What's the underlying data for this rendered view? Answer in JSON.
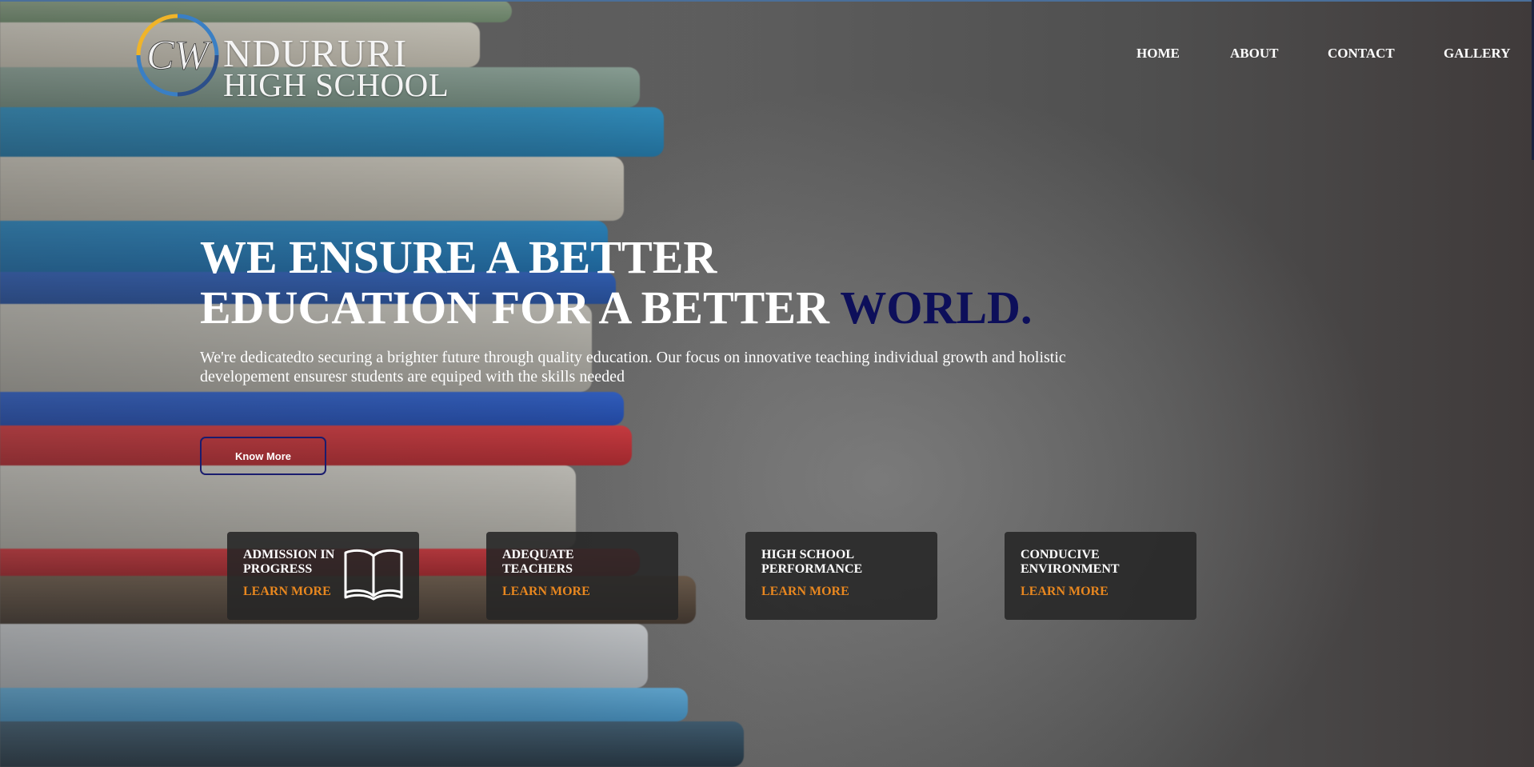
{
  "logo": {
    "monogram": "CW",
    "line1": "NDURURI",
    "line2": "HIGH SCHOOL"
  },
  "nav": {
    "items": [
      {
        "label": "HOME"
      },
      {
        "label": "ABOUT"
      },
      {
        "label": "CONTACT"
      },
      {
        "label": "GALLERY"
      }
    ]
  },
  "hero": {
    "title_line1": "WE ENSURE A BETTER",
    "title_line2": "EDUCATION FOR A BETTER",
    "title_accent": "WORLD.",
    "description": "We're dedicatedto securing a brighter future through quality education. Our focus on innovative teaching individual growth and holistic developement ensuresr students are equiped with the skills needed",
    "button_label": "Know More"
  },
  "cards": [
    {
      "title": "ADMISSION IN PROGRESS",
      "link": "LEARN MORE",
      "icon": "open-book-icon"
    },
    {
      "title": "ADEQUATE TEACHERS",
      "link": "LEARN MORE"
    },
    {
      "title": "HIGH SCHOOL PERFORMANCE",
      "link": "LEARN MORE"
    },
    {
      "title": "CONDUCIVE ENVIRONMENT",
      "link": "LEARN MORE"
    }
  ],
  "colors": {
    "accent_navy": "#0d0f5a",
    "link_orange": "#e8871f",
    "card_bg": "#262626",
    "logo_ring_blue": "#3a7fc4",
    "logo_ring_yellow": "#f0b429"
  }
}
